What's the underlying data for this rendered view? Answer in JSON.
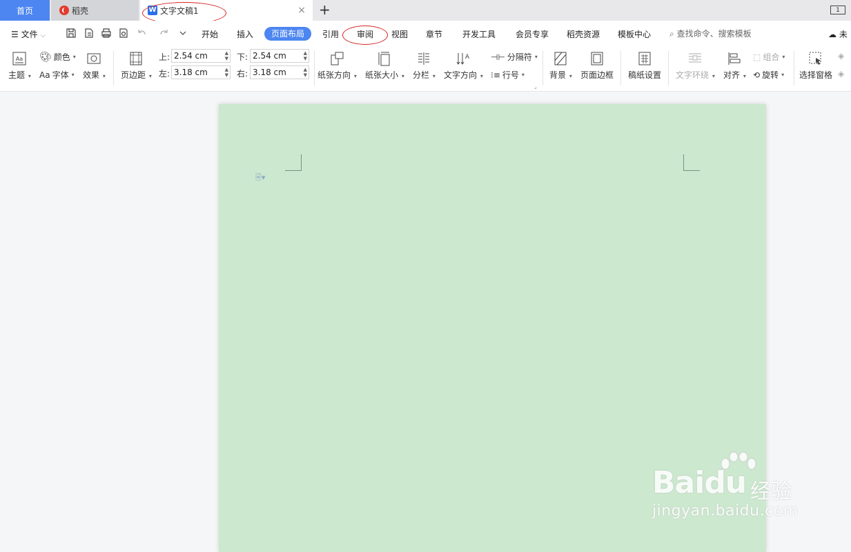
{
  "tabs": {
    "home": "首页",
    "daoke": "稻壳",
    "document": "文字文稿1",
    "close": "×",
    "new_tab": "+",
    "window_btn": "1"
  },
  "menu": {
    "file": "文件",
    "items": [
      "开始",
      "插入",
      "页面布局",
      "引用",
      "审阅",
      "视图",
      "章节",
      "开发工具",
      "会员专享",
      "稻壳资源",
      "模板中心"
    ],
    "active": "页面布局",
    "search": "查找命令、搜索模板",
    "cloud": "未"
  },
  "ribbon": {
    "theme": "主题",
    "color": "颜色",
    "font": "字体",
    "font_prefix": "Aa",
    "effect": "效果",
    "margins": "页边距",
    "margin_top_label": "上:",
    "margin_top": "2.54 cm",
    "margin_bottom_label": "下:",
    "margin_bottom": "2.54 cm",
    "margin_left_label": "左:",
    "margin_left": "3.18 cm",
    "margin_right_label": "右:",
    "margin_right": "3.18 cm",
    "orientation": "纸张方向",
    "paper_size": "纸张大小",
    "columns": "分栏",
    "text_direction": "文字方向",
    "breaks": "分隔符",
    "line_numbers": "行号",
    "background": "背景",
    "page_border": "页面边框",
    "manuscript": "稿纸设置",
    "wrap_text": "文字环绕",
    "align": "对齐",
    "group": "组合",
    "rotate": "旋转",
    "selection_pane": "选择窗格"
  },
  "watermark": {
    "brand": "Bai",
    "brand2": "du",
    "cn": "经验",
    "url": "jingyan.baidu.com"
  },
  "colors": {
    "accent": "#4d86f0",
    "page": "#cce8cf",
    "annotation": "#d62020"
  }
}
